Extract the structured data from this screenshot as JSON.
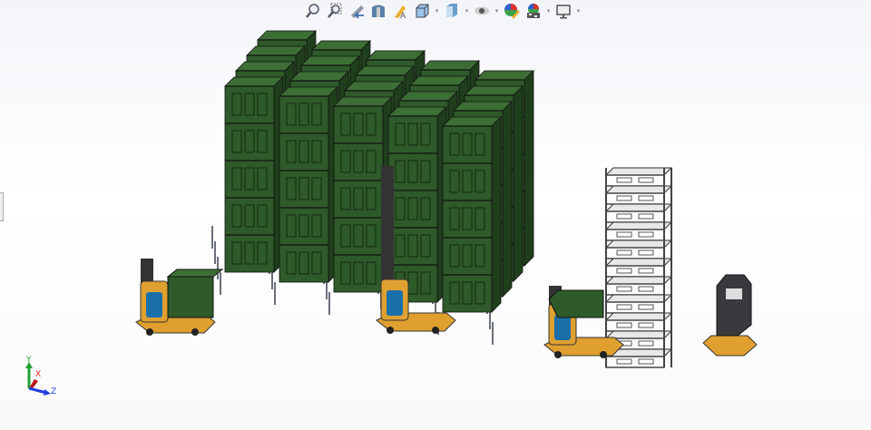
{
  "toolbar": {
    "items": [
      {
        "icon": "zoom-to-fit-icon",
        "dropdown": false
      },
      {
        "icon": "zoom-to-area-icon",
        "dropdown": false
      },
      {
        "icon": "previous-view-icon",
        "dropdown": false
      },
      {
        "icon": "section-view-icon",
        "dropdown": false
      },
      {
        "icon": "dynamic-annotation-views-icon",
        "dropdown": false
      },
      {
        "icon": "view-orientation-icon",
        "dropdown": true
      },
      {
        "icon": "display-style-icon",
        "dropdown": true
      },
      {
        "icon": "hide-show-items-icon",
        "dropdown": true
      },
      {
        "icon": "edit-appearance-icon",
        "dropdown": false
      },
      {
        "icon": "apply-scene-icon",
        "dropdown": true
      },
      {
        "icon": "view-settings-icon",
        "dropdown": true
      }
    ]
  },
  "triad": {
    "x": "X",
    "y": "Y",
    "z": "Z"
  },
  "colors": {
    "crate": "#2f5a2a",
    "robot": "#e0a030",
    "battery": "#1a6fa8",
    "rack": "#6a6e78",
    "x": "#e02020",
    "y": "#20a030",
    "z": "#2040e0"
  }
}
